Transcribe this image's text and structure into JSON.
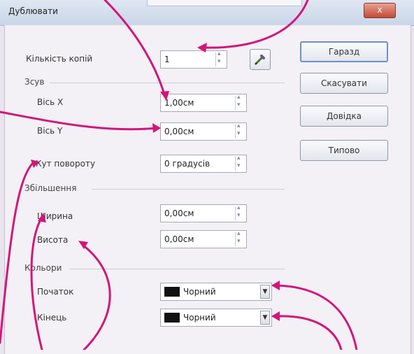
{
  "window": {
    "title": "Дублювати",
    "close_glyph": "x"
  },
  "labels": {
    "copies": "Кількість копій",
    "shift_section": "Зсув",
    "axis_x": "Вісь X",
    "axis_y": "Вісь Y",
    "rotation": "Кут повороту",
    "enlargement_section": "Збільшення",
    "width": "Ширина",
    "height": "Висота",
    "colors_section": "Кольори",
    "start": "Початок",
    "end": "Кінець"
  },
  "fields": {
    "copies": "1",
    "axis_x": "1,00см",
    "axis_y": "0,00см",
    "rotation": "0 градусів",
    "width": "0,00см",
    "height": "0,00см"
  },
  "colors": {
    "start": {
      "name": "Чорний",
      "swatch": "#111111"
    },
    "end": {
      "name": "Чорний",
      "swatch": "#111111"
    }
  },
  "buttons": {
    "ok": "Гаразд",
    "cancel": "Скасувати",
    "help": "Довідка",
    "reset": "Типово"
  },
  "icons": {
    "picker": "eyedropper-icon"
  },
  "annotation_color": "#d4147a"
}
